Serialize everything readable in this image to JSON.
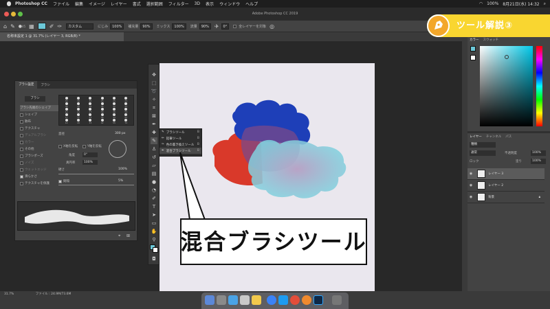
{
  "menubar": {
    "app_name": "Photoshop CC",
    "items": [
      "ファイル",
      "編集",
      "イメージ",
      "レイヤー",
      "書式",
      "選択範囲",
      "フィルター",
      "3D",
      "表示",
      "ウィンドウ",
      "ヘルプ"
    ],
    "battery": "100%",
    "datetime": "8月21日(水) 14:32"
  },
  "window": {
    "title": "Adobe Photoshop CC 2019"
  },
  "options": {
    "size": "45",
    "mode": "カスタム",
    "wet_label": "にじみ",
    "wet": "100%",
    "load_label": "補充量",
    "load": "90%",
    "mix_label": "ミックス",
    "mix": "100%",
    "flow_label": "流量",
    "flow": "90%",
    "angle": "0°",
    "sample_all": "全レイヤーを対象"
  },
  "document": {
    "tab": "名称未設定 1 @ 31.7% (レイヤー 3, RGB/8) *"
  },
  "brush_panel": {
    "tabs": [
      "ブラシ設定",
      "ブラシ"
    ],
    "brush_button": "ブラシ",
    "options": [
      {
        "label": "ブラシ先端のシェイプ",
        "checked": false,
        "selected": true
      },
      {
        "label": "シェイプ",
        "checked": false,
        "selected": false
      },
      {
        "label": "散布",
        "checked": false,
        "selected": false
      },
      {
        "label": "テクスチャ",
        "checked": false,
        "selected": false
      },
      {
        "label": "デュアルブラシ",
        "checked": false,
        "selected": false
      },
      {
        "label": "カラー",
        "checked": false,
        "selected": false
      },
      {
        "label": "その他",
        "checked": false,
        "selected": false
      },
      {
        "label": "ブラシポーズ",
        "checked": false,
        "selected": false
      },
      {
        "label": "ノイズ",
        "checked": false,
        "selected": false
      },
      {
        "label": "ウェットエッジ",
        "checked": false,
        "selected": false
      },
      {
        "label": "滑らかさ",
        "checked": true,
        "selected": false
      },
      {
        "label": "テクスチャを保護",
        "checked": false,
        "selected": false
      }
    ],
    "tip_sizes": [
      "30",
      "30",
      "30",
      "25",
      "25",
      "25",
      "36",
      "25",
      "36",
      "36",
      "32",
      "25",
      "14",
      "24",
      "27",
      "39",
      "46",
      "59",
      "11",
      "17",
      "23",
      "36",
      "44",
      "60",
      "14",
      "26",
      "33",
      "42",
      "55",
      "70"
    ],
    "size_label": "直径",
    "size_value": "300 px",
    "flip_x": "X軸を反転",
    "flip_y": "Y軸を反転",
    "angle_label": "角度",
    "angle_value": "0°",
    "roundness_label": "真円率",
    "roundness_value": "100%",
    "hardness_label": "硬さ",
    "hardness_value": "100%",
    "spacing_label": "間隔",
    "spacing_value": "5%"
  },
  "flyout": [
    {
      "label": "ブラシツール",
      "key": "B"
    },
    {
      "label": "鉛筆ツール",
      "key": "B"
    },
    {
      "label": "色の置き換えツール",
      "key": "B"
    },
    {
      "label": "混合ブラシツール",
      "key": "B"
    }
  ],
  "color_panel": {
    "tabs": [
      "カラー",
      "スウォッチ"
    ]
  },
  "layers_panel": {
    "tabs": [
      "レイヤー",
      "チャンネル",
      "パス"
    ],
    "kind": "種類",
    "blend": "通常",
    "opacity_label": "不透明度",
    "opacity": "100%",
    "lock_label": "ロック",
    "fill_label": "塗り",
    "fill": "100%",
    "layers": [
      {
        "name": "レイヤー 3",
        "selected": true
      },
      {
        "name": "レイヤー 2",
        "selected": false
      },
      {
        "name": "背景",
        "selected": false
      }
    ]
  },
  "status": {
    "zoom": "31.7%",
    "info": "ファイル : 24.9M/73.6M"
  },
  "badge": {
    "text": "ツール解説③"
  },
  "callout": {
    "text": "混合ブラシツール"
  },
  "colors": {
    "fg": "#6cc8d8",
    "paint_red": "#d9392a",
    "paint_blue": "#1e3fb8",
    "paint_cyan": "#7ed3df",
    "badge": "#f9d630"
  }
}
